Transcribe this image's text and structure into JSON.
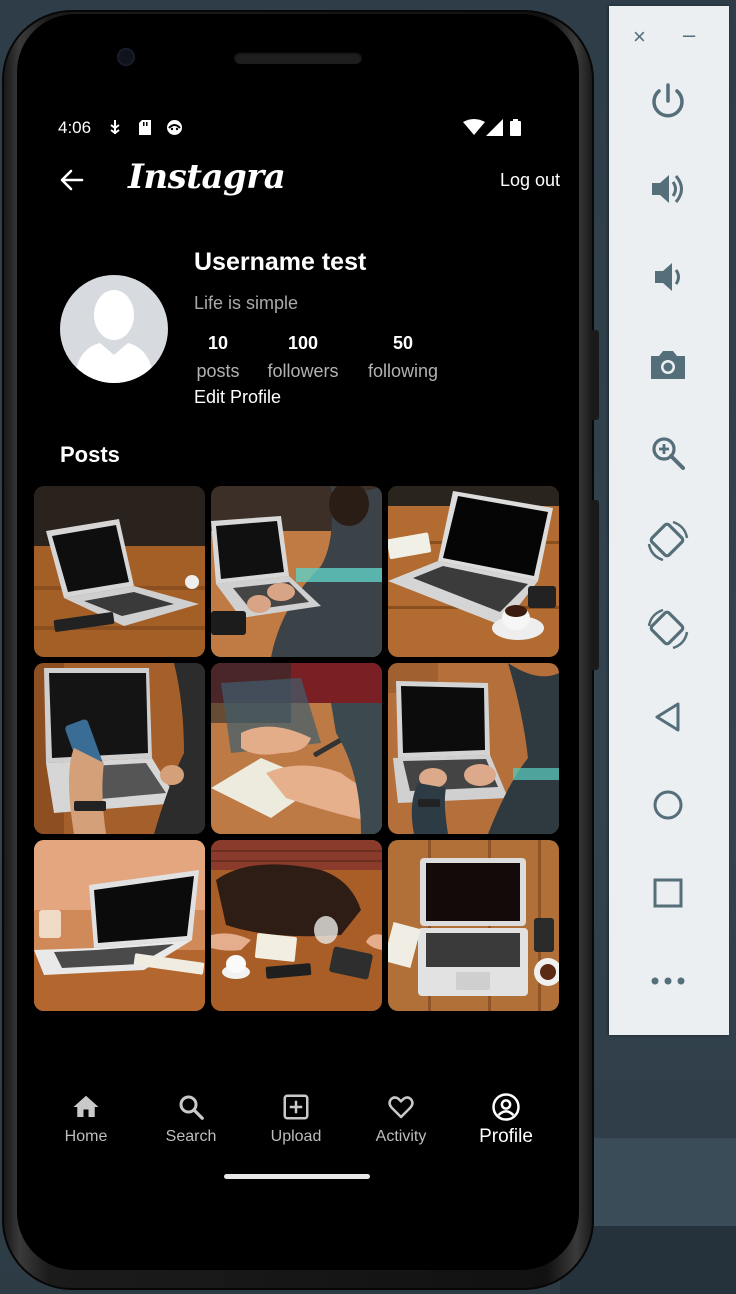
{
  "status_bar": {
    "time": "4:06"
  },
  "header": {
    "logo_text": "Instagram",
    "logout_label": "Log out"
  },
  "profile": {
    "username": "Username test",
    "bio": "Life is simple",
    "stats": [
      {
        "value": "10",
        "label": "posts"
      },
      {
        "value": "100",
        "label": "followers"
      },
      {
        "value": "50",
        "label": "following"
      }
    ],
    "edit_label": "Edit Profile"
  },
  "posts": {
    "title": "Posts",
    "items": [
      "laptop-on-table",
      "person-typing-laptop",
      "laptop-and-coffee",
      "hand-holding-phone",
      "hands-writing-notebook",
      "hands-typing-laptop",
      "laptop-in-cafe",
      "bag-and-coffee-table",
      "laptop-top-view"
    ]
  },
  "bottom_nav": {
    "items": [
      {
        "label": "Home",
        "icon": "home-icon"
      },
      {
        "label": "Search",
        "icon": "search-icon"
      },
      {
        "label": "Upload",
        "icon": "add-box-icon"
      },
      {
        "label": "Activity",
        "icon": "heart-icon"
      },
      {
        "label": "Profile",
        "icon": "account-circle-icon",
        "active": true
      }
    ]
  },
  "emulator_toolbar": {
    "close": "×",
    "minimize": "–",
    "buttons": [
      "power-icon",
      "volume-up-icon",
      "volume-down-icon",
      "camera-icon",
      "zoom-in-icon",
      "rotate-left-icon",
      "rotate-right-icon",
      "back-icon",
      "home-circle-icon",
      "overview-icon",
      "more-icon"
    ]
  },
  "colors": {
    "screen_bg": "#000000",
    "toolbar_bg": "#eceff1",
    "toolbar_icon": "#546e7a",
    "avatar_bg": "#d7dbe0",
    "wood": "#a8642c"
  }
}
